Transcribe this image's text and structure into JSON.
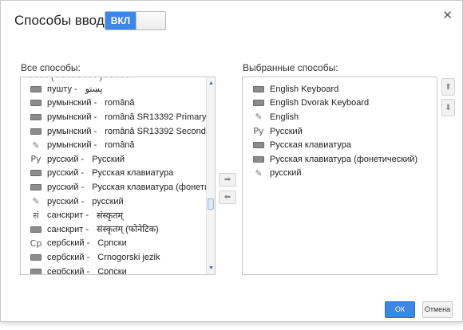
{
  "dialog": {
    "title": "Способы ввода",
    "toggle_label": "ВКЛ",
    "close_symbol": "✕"
  },
  "all_methods": {
    "label": "Все способы:",
    "partial_row": "· · ·  · ( · · · · · · · · )  · · · · ·",
    "items": [
      {
        "icon": "keyboard-icon",
        "lang": "пушту -",
        "method": "پښتو"
      },
      {
        "icon": "keyboard-icon",
        "lang": "румынский -",
        "method": "română"
      },
      {
        "icon": "keyboard-icon",
        "lang": "румынский -",
        "method": "română SR13392 Primary"
      },
      {
        "icon": "keyboard-icon",
        "lang": "румынский -",
        "method": "română SR13392 Secondary"
      },
      {
        "icon": "pencil-icon",
        "lang": "румынский -",
        "method": "română"
      },
      {
        "icon": "ru-script-icon",
        "lang": "русский -",
        "method": "Русский"
      },
      {
        "icon": "keyboard-icon",
        "lang": "русский -",
        "method": "Русская клавиатура"
      },
      {
        "icon": "keyboard-icon",
        "lang": "русский -",
        "method": "Русская клавиатура (фонетический)"
      },
      {
        "icon": "pencil-icon",
        "lang": "русский -",
        "method": "русский"
      },
      {
        "icon": "devanagari-script-icon",
        "lang": "санскрит -",
        "method": "संस्कृतम्"
      },
      {
        "icon": "keyboard-icon",
        "lang": "санскрит -",
        "method": "संस्कृतम् (फोनेटिक)"
      },
      {
        "icon": "cyrillic-sr-script-icon",
        "lang": "сербский -",
        "method": "Српски"
      },
      {
        "icon": "keyboard-icon",
        "lang": "сербский -",
        "method": "Crnogorski jezik"
      },
      {
        "icon": "keyboard-icon",
        "lang": "сербский -",
        "method": "Српски"
      }
    ]
  },
  "selected_methods": {
    "label": "Выбранные способы:",
    "items": [
      {
        "icon": "keyboard-icon",
        "name": "English Keyboard"
      },
      {
        "icon": "keyboard-icon",
        "name": "English Dvorak Keyboard"
      },
      {
        "icon": "pencil-icon",
        "name": "English"
      },
      {
        "icon": "ru-script-icon",
        "name": "Русский"
      },
      {
        "icon": "keyboard-icon",
        "name": "Русская клавиатура"
      },
      {
        "icon": "keyboard-icon",
        "name": "Русская клавиатура (фонетический)"
      },
      {
        "icon": "pencil-icon",
        "name": "русский"
      }
    ]
  },
  "icon_glyphs": {
    "pencil-icon": "✎",
    "ru-script-icon": "Ру",
    "devanagari-script-icon": "सं",
    "cyrillic-sr-script-icon": "Ср"
  },
  "buttons": {
    "ok": "ОК",
    "cancel": "Отмена"
  },
  "colors": {
    "accent": "#3d85e6"
  }
}
